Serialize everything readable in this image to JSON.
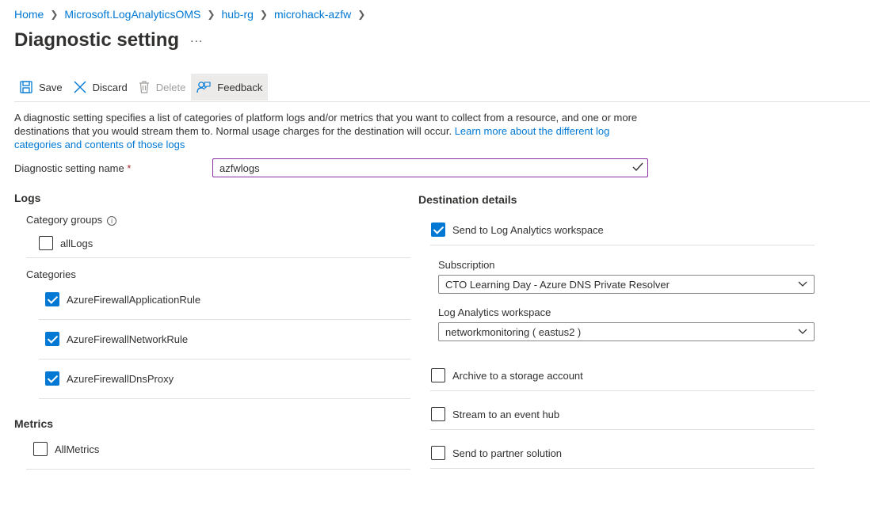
{
  "breadcrumb": [
    "Home",
    "Microsoft.LogAnalyticsOMS",
    "hub-rg",
    "microhack-azfw"
  ],
  "page": {
    "title": "Diagnostic setting",
    "more": "..."
  },
  "toolbar": {
    "save": "Save",
    "discard": "Discard",
    "delete": "Delete",
    "feedback": "Feedback"
  },
  "description": {
    "text": "A diagnostic setting specifies a list of categories of platform logs and/or metrics that you want to collect from a resource, and one or more destinations that you would stream them to. Normal usage charges for the destination will occur.",
    "link": "Learn more about the different log categories and contents of those logs"
  },
  "name_field": {
    "label": "Diagnostic setting name",
    "required": "*",
    "value": "azfwlogs"
  },
  "logs": {
    "title": "Logs",
    "category_groups_label": "Category groups",
    "all_logs": {
      "label": "allLogs",
      "checked": false
    },
    "categories_label": "Categories",
    "categories": [
      {
        "label": "AzureFirewallApplicationRule",
        "checked": true
      },
      {
        "label": "AzureFirewallNetworkRule",
        "checked": true
      },
      {
        "label": "AzureFirewallDnsProxy",
        "checked": true
      }
    ]
  },
  "metrics": {
    "title": "Metrics",
    "all_metrics": {
      "label": "AllMetrics",
      "checked": false
    }
  },
  "destination": {
    "title": "Destination details",
    "log_analytics": {
      "label": "Send to Log Analytics workspace",
      "checked": true
    },
    "subscription": {
      "label": "Subscription",
      "value": "CTO Learning Day - Azure DNS Private Resolver"
    },
    "workspace": {
      "label": "Log Analytics workspace",
      "value": "networkmonitoring ( eastus2 )"
    },
    "archive": {
      "label": "Archive to a storage account",
      "checked": false
    },
    "event_hub": {
      "label": "Stream to an event hub",
      "checked": false
    },
    "partner": {
      "label": "Send to partner solution",
      "checked": false
    }
  },
  "colors": {
    "accent": "#0078d4",
    "focus_border": "#8a2da5",
    "check_ok": "#107c10"
  }
}
